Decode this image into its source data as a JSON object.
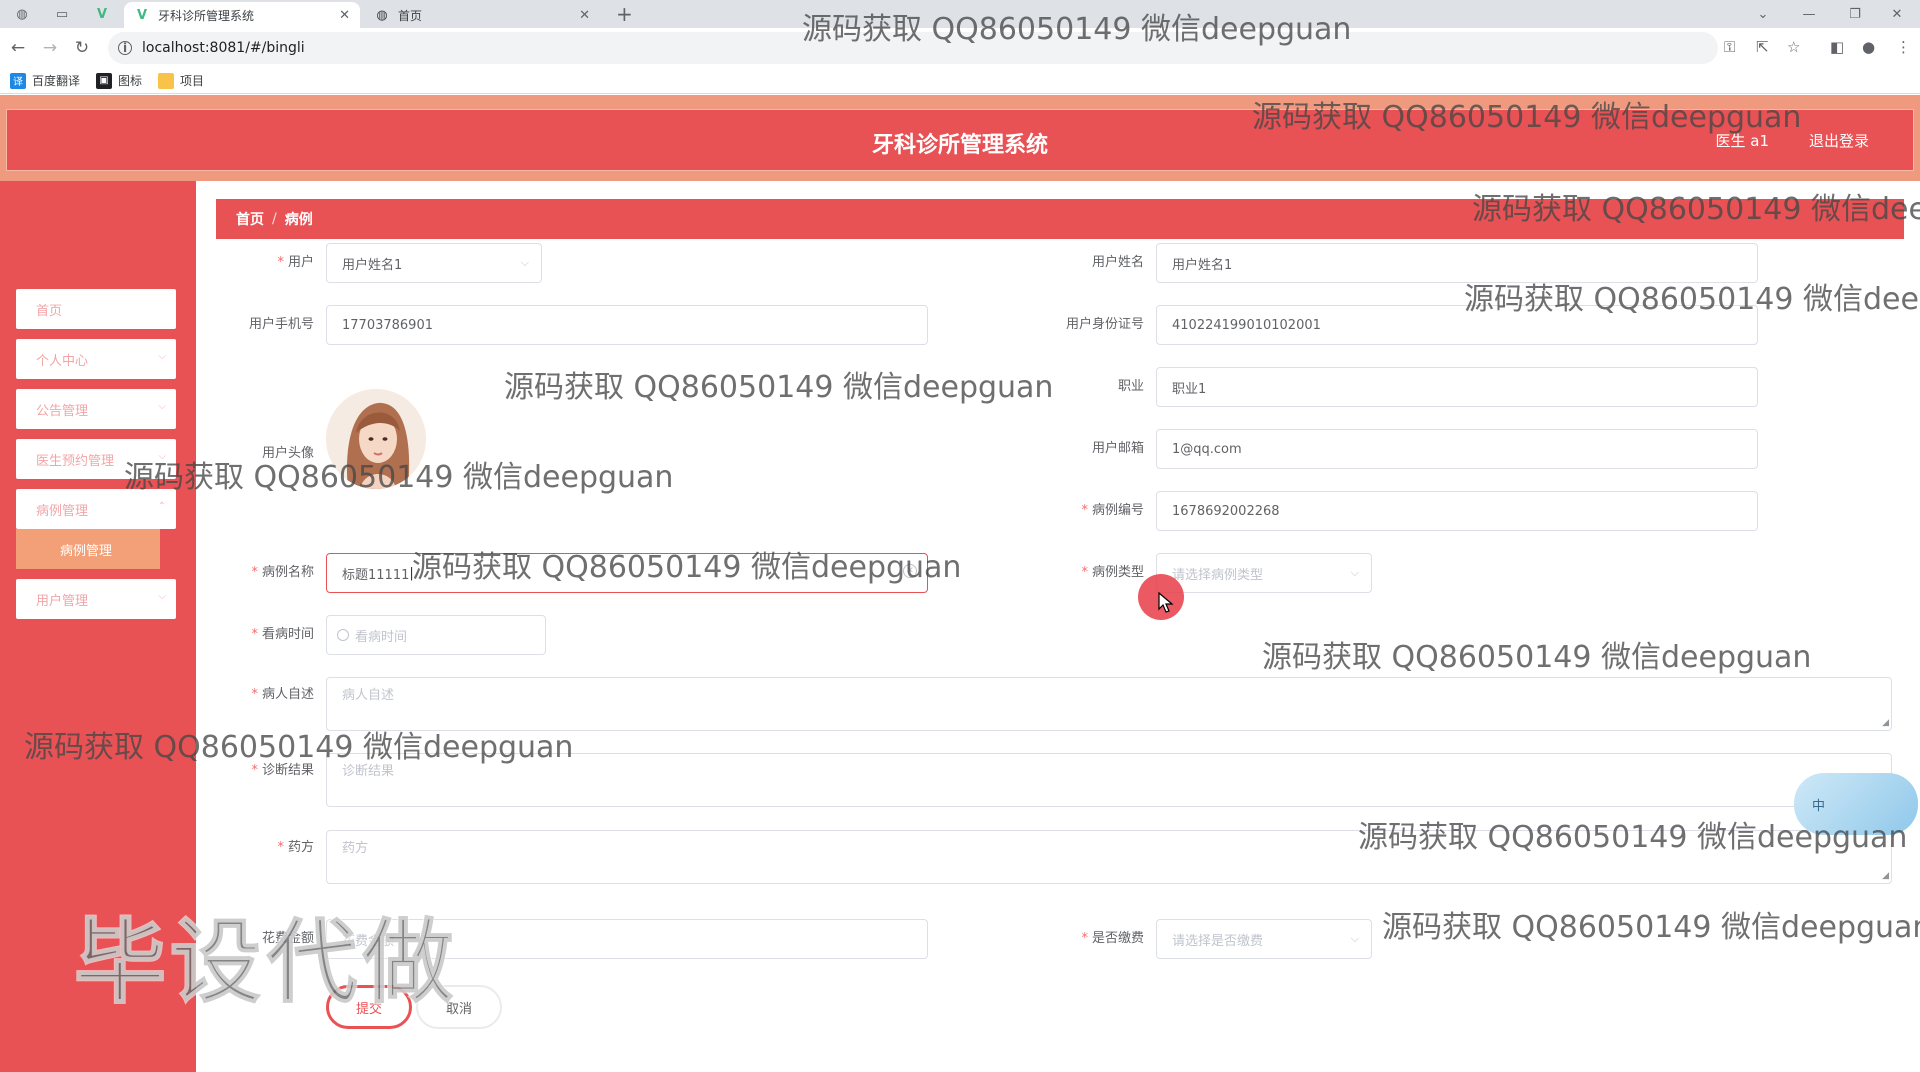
{
  "browser": {
    "tabs": [
      {
        "title": "牙科诊所管理系统",
        "active": true
      },
      {
        "title": "首页",
        "active": false
      }
    ],
    "new_tab_symbol": "+",
    "url": "localhost:8081/#/bingli",
    "bookmarks": [
      {
        "label": "百度翻译",
        "icon": "translate-icon",
        "color": "#1e88e5"
      },
      {
        "label": "图标",
        "icon": "image-icon",
        "color": "#202124"
      },
      {
        "label": "项目",
        "icon": "folder-icon",
        "color": "#f9c349"
      }
    ]
  },
  "header": {
    "title": "牙科诊所管理系统",
    "user": "医生 a1",
    "logout": "退出登录"
  },
  "sidebar": {
    "items": [
      {
        "label": "首页"
      },
      {
        "label": "个人中心"
      },
      {
        "label": "公告管理"
      },
      {
        "label": "医生预约管理"
      },
      {
        "label": "病例管理"
      },
      {
        "label": "用户管理"
      }
    ],
    "submenu": {
      "label": "病例管理"
    }
  },
  "breadcrumb": {
    "home": "首页",
    "separator": "/",
    "current": "病例"
  },
  "form": {
    "user": {
      "label": "用户",
      "value": "用户姓名1"
    },
    "user_name": {
      "label": "用户姓名",
      "value": "用户姓名1"
    },
    "phone": {
      "label": "用户手机号",
      "value": "17703786901"
    },
    "id_card": {
      "label": "用户身份证号",
      "value": "410224199010102001"
    },
    "avatar": {
      "label": "用户头像"
    },
    "job": {
      "label": "职业",
      "value": "职业1"
    },
    "email": {
      "label": "用户邮箱",
      "value": "1@qq.com"
    },
    "case_no": {
      "label": "病例编号",
      "value": "1678692002268"
    },
    "case_name": {
      "label": "病例名称",
      "value": "标题11111"
    },
    "case_type": {
      "label": "病例类型",
      "placeholder": "请选择病例类型"
    },
    "visit_time": {
      "label": "看病时间",
      "placeholder": "看病时间"
    },
    "self_report": {
      "label": "病人自述",
      "placeholder": "病人自述"
    },
    "diagnosis": {
      "label": "诊断结果",
      "placeholder": "诊断结果"
    },
    "prescription": {
      "label": "药方",
      "placeholder": "药方"
    },
    "fee": {
      "label": "花费金额",
      "placeholder": "花费金额"
    },
    "paid": {
      "label": "是否缴费",
      "placeholder": "请选择是否缴费"
    },
    "submit": "提交",
    "cancel": "取消"
  },
  "ime": {
    "label": "中"
  },
  "watermarks": {
    "text": "源码获取 QQ86050149 微信deepguan",
    "big": "毕设代做"
  },
  "colors": {
    "primary": "#e95255",
    "accent": "#f3a078",
    "required": "#f56c6c"
  }
}
